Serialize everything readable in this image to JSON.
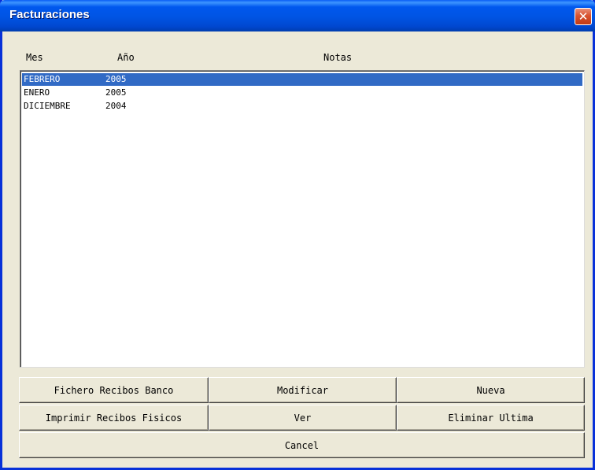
{
  "window": {
    "title": "Facturaciones",
    "close_glyph": "✕"
  },
  "columns": {
    "mes": "Mes",
    "anio": "Año",
    "notas": "Notas"
  },
  "rows": [
    {
      "mes": "FEBRERO",
      "anio": "2005",
      "notas": ""
    },
    {
      "mes": "ENERO",
      "anio": "2005",
      "notas": ""
    },
    {
      "mes": "DICIEMBRE",
      "anio": "2004",
      "notas": ""
    }
  ],
  "buttons": {
    "fichero": "Fichero Recibos Banco",
    "modificar": "Modificar",
    "nueva": "Nueva",
    "imprimir": "Imprimir Recibos Fisicos",
    "ver": "Ver",
    "eliminar": "Eliminar Ultima",
    "cancel": "Cancel"
  }
}
